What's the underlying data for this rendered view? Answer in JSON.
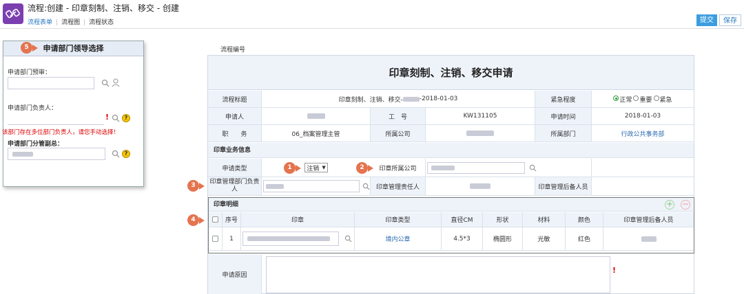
{
  "header": {
    "title": "流程:创建 - 印章刻制、注销、移交 - 创建",
    "tabs": [
      "流程表单",
      "流程图",
      "流程状态"
    ],
    "submit_label": "提交",
    "save_label": "保存"
  },
  "left_panel": {
    "marker": "5",
    "title": "申请部门领导选择",
    "dept_head_label": "申请部门预审：",
    "dept_leader_label": "申请部门负责人：",
    "warning": "该部门存在多位部门负责人，请您手动选择！",
    "supervisor_label": "申请部门分管副总：",
    "required_mark": "!",
    "help_mark": "?"
  },
  "form": {
    "flow_no_label": "流程编号",
    "title": "印章刻制、注销、移交申请",
    "row1": {
      "title_label": "流程标题",
      "title_value_prefix": "印章刻制、注销、移交-",
      "title_value_suffix": "-2018-01-03",
      "urgency_label": "紧急程度",
      "urgency_options": [
        "正常",
        "重要",
        "紧急"
      ],
      "urgency_selected": "正常"
    },
    "row2": {
      "applicant_label": "申请人",
      "job_no_label": "工　号",
      "job_no_value": "KW131105",
      "apply_time_label": "申请时间",
      "apply_time_value": "2018-01-03"
    },
    "row3": {
      "position_label": "职　　务",
      "position_value": "06_档案管理主管",
      "company_label": "所属公司",
      "dept_label": "所属部门",
      "dept_value": "行政公共事务部"
    },
    "business_section": "印章业务信息",
    "apply_type_label": "申请类型",
    "apply_type_value": "注销",
    "seal_company_label": "印章所属公司",
    "seal_dept_head_label": "印章管理部门负责人",
    "seal_keeper_label": "印章管理责任人",
    "seal_backup_label": "印章管理后备人员",
    "detail_section": "印章明细",
    "detail_columns": [
      "序号",
      "印章",
      "印章类型",
      "直径CM",
      "形状",
      "材料",
      "颜色",
      "印章管理后备人员"
    ],
    "detail_rows": [
      {
        "no": "1",
        "seal_type": "境内公章",
        "diameter": "4.5*3",
        "shape": "椭圆形",
        "material": "光敏",
        "color": "红色"
      }
    ],
    "reason_label": "申请原因",
    "markers": [
      "1",
      "2",
      "3",
      "4"
    ]
  },
  "colors": {
    "accent": "#3a9de0",
    "marker": "#e4744f",
    "logo": "#7b3fb0",
    "label_bg": "#eef3fa"
  }
}
